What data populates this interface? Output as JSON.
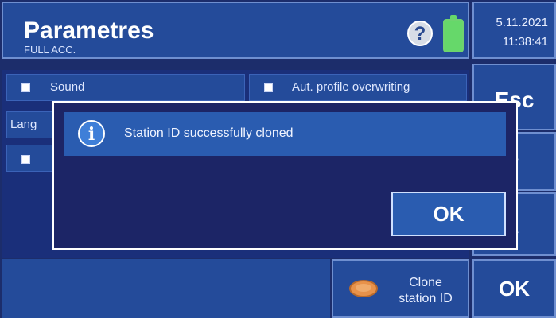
{
  "header": {
    "title": "Parametres",
    "subtitle": "FULL ACC.",
    "help_icon": "?",
    "date": "5.11.2021",
    "time": "11:38:41"
  },
  "params": {
    "sound_label": "Sound",
    "aut_profile_label": "Aut. profile overwriting",
    "language_label_partial": "Lang"
  },
  "side_buttons": {
    "esc_label": "Esc",
    "up_arrow": "↑",
    "down_arrow": "↓",
    "ok_label": "OK"
  },
  "bottom": {
    "clone_label_line1": "Clone",
    "clone_label_line2": "station ID"
  },
  "modal": {
    "info_icon": "i",
    "message": "Station ID successfully cloned",
    "ok_label": "OK"
  },
  "colors": {
    "background": "#1c2d6b",
    "panel": "#244b9a",
    "modal_bg": "#1c2566",
    "message_bar": "#2a5cb0",
    "battery": "#66d86a"
  }
}
